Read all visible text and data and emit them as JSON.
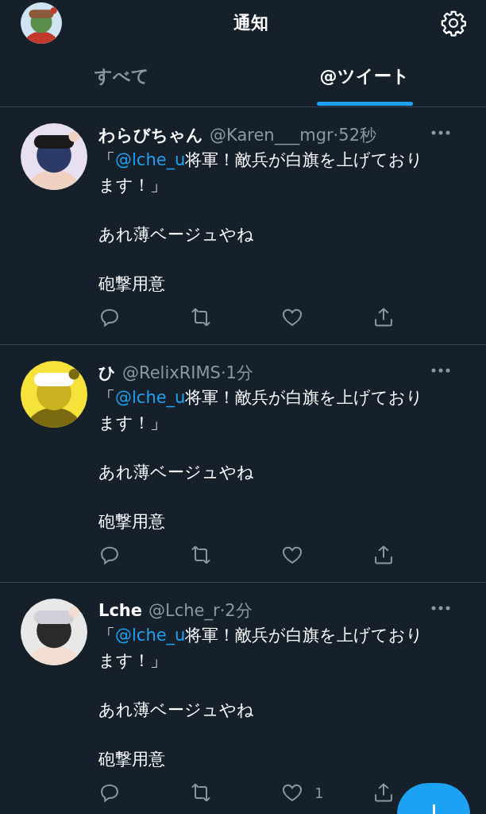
{
  "header": {
    "title": "通知"
  },
  "tabs": [
    {
      "label": "すべて",
      "selected": false
    },
    {
      "label": "@ツイート",
      "selected": true
    }
  ],
  "tweets": [
    {
      "name": "わらびちゃん",
      "handle_time": "@Karen___mgr·52秒",
      "lead": {
        "prefix": "「",
        "mention": "@lche_u",
        "text": "将軍！敵兵が白旗を上げております！」"
      },
      "paragraphs": [
        "あれ薄ベージュやね",
        "砲撃用意"
      ],
      "actions": [
        {
          "kind": "reply"
        },
        {
          "kind": "retweet"
        },
        {
          "kind": "like"
        },
        {
          "kind": "share"
        }
      ]
    },
    {
      "name": "ひ",
      "handle_time": "@RelixRIMS·1分",
      "lead": {
        "prefix": "「",
        "mention": "@lche_u",
        "text": "将軍！敵兵が白旗を上げております！」"
      },
      "paragraphs": [
        "あれ薄ベージュやね",
        "砲撃用意"
      ],
      "actions": [
        {
          "kind": "reply"
        },
        {
          "kind": "retweet"
        },
        {
          "kind": "like"
        },
        {
          "kind": "share"
        }
      ]
    },
    {
      "name": "Lche",
      "handle_time": "@Lche_r·2分",
      "lead": {
        "prefix": "「",
        "mention": "@lche_u",
        "text": "将軍！敵兵が白旗を上げております！」"
      },
      "paragraphs": [
        "あれ薄ベージュやね",
        "砲撃用意"
      ],
      "actions": [
        {
          "kind": "reply"
        },
        {
          "kind": "retweet"
        },
        {
          "kind": "like",
          "count": "1"
        },
        {
          "kind": "share"
        }
      ]
    }
  ]
}
